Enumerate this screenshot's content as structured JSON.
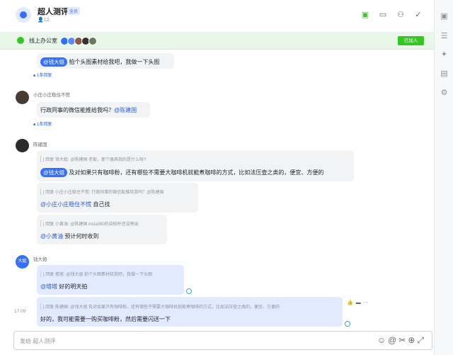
{
  "header": {
    "title": "超人测评",
    "badge": "全员",
    "member_count": "12",
    "actions": [
      "meeting-icon",
      "video-icon",
      "add-member-icon",
      "check-icon"
    ]
  },
  "office": {
    "label": "线上办公室",
    "joined_label": "已加入"
  },
  "messages": {
    "m1": {
      "mention": "@钱大姐",
      "text": " 拍个头图素材给我吧，我做一下头图",
      "replies": "1条回复"
    },
    "m2": {
      "sender": "小庄小庄稳住不慌",
      "text": "行政同事的微信能推给我吗？",
      "mention": "@陈建国",
      "replies": "1条回复"
    },
    "m3": {
      "sender": "陈建国",
      "quote1": "| 回复 钱大姐: @陈建国 老板，那个器具指的是什么呀?",
      "mention1": "@钱大姐",
      "text1": " 及对如果只有咖啡粉，还有哪些不需要大咖啡机就能煮咖啡的方式，比如法压壶之类的，便宜、方便的",
      "quote2": "| 回复 小庄小庄稳住不慌: 行政同事的微信能推给我吗？@陈建国",
      "mention2": "@小庄小庄稳住不慌",
      "text2": " 自己找",
      "quote3": "| 回复 小黄油: @陈建国 insta360的自拍杆还没寄出",
      "mention3": "@小黄油",
      "text3": " 预计何时收到"
    },
    "m4": {
      "sender": "钱大姐",
      "avatar_label": "大姐",
      "quote1": "| 回复 塔塔: @钱大姐 拍个头图素材给我吧，我做一下头图",
      "mention1": "@塔塔",
      "text1": " 好的明天拍",
      "time": "17:09",
      "quote2": "| 回复 陈建国: @钱大姐 及对如果只有咖啡粉，还有哪些不需要大咖啡机就能煮咖啡的方式，比如法压壶之类的，便宜、方便的",
      "text2": "好的，我可能需要一购买咖啡粉，然后需要闪送一下"
    }
  },
  "input": {
    "placeholder": "发给 超人测评",
    "icons": [
      "emoji-icon",
      "at-icon",
      "scissors-icon",
      "plus-icon",
      "expand-icon"
    ]
  },
  "right_rail": [
    "briefcase-icon",
    "list-icon",
    "pin-icon",
    "doc-icon",
    "settings-icon"
  ],
  "colors": {
    "accent": "#3370ff",
    "green": "#34c724",
    "banner_bg": "#e9f7e9"
  }
}
